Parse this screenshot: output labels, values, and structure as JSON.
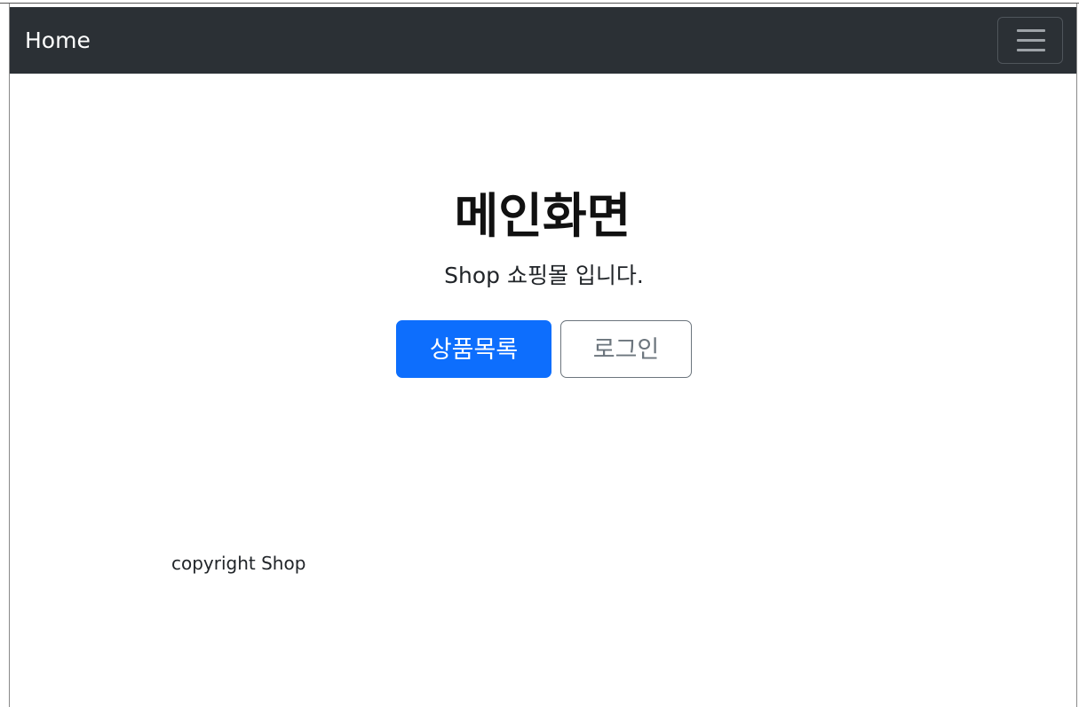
{
  "navbar": {
    "brand": "Home",
    "toggler_icon": "hamburger-menu-icon",
    "background": "#2b3035"
  },
  "hero": {
    "title": "메인화면",
    "subtitle": "Shop 쇼핑몰 입니다.",
    "primary_button": "상품목록",
    "secondary_button": "로그인"
  },
  "footer": {
    "text": "copyright Shop"
  },
  "colors": {
    "primary": "#0d6efd",
    "secondary": "#6c757d"
  }
}
